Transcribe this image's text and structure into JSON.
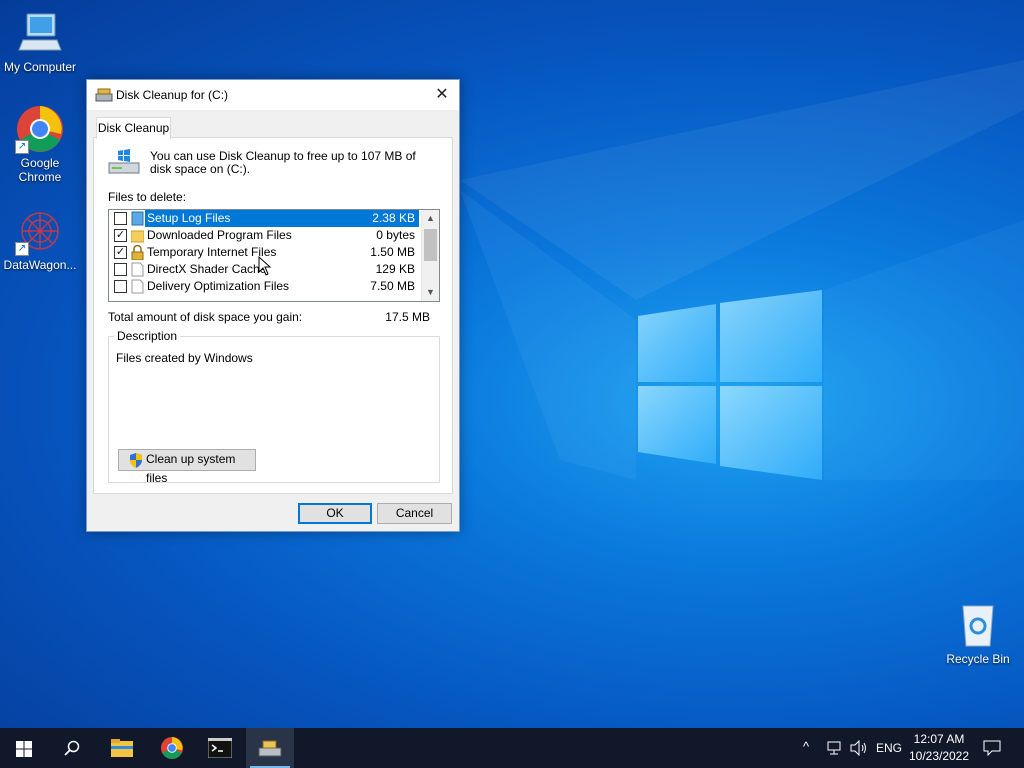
{
  "desktop": {
    "icons": [
      {
        "label": "My Computer"
      },
      {
        "label": "Google Chrome"
      },
      {
        "label": "DataWagon..."
      },
      {
        "label": "Recycle Bin"
      }
    ]
  },
  "dialog": {
    "title": "Disk Cleanup for  (C:)",
    "tab": "Disk Cleanup",
    "intro": "You can use Disk Cleanup to free up to 107 MB of disk space on  (C:).",
    "files_label": "Files to delete:",
    "files": [
      {
        "name": "Setup Log Files",
        "size": "2.38 KB",
        "checked": false,
        "selected": true,
        "icon": "log-file-icon"
      },
      {
        "name": "Downloaded Program Files",
        "size": "0 bytes",
        "checked": true,
        "selected": false,
        "icon": "folder-icon"
      },
      {
        "name": "Temporary Internet Files",
        "size": "1.50 MB",
        "checked": true,
        "selected": false,
        "icon": "lock-icon"
      },
      {
        "name": "DirectX Shader Cache",
        "size": "129 KB",
        "checked": false,
        "selected": false,
        "icon": "file-icon"
      },
      {
        "name": "Delivery Optimization Files",
        "size": "7.50 MB",
        "checked": false,
        "selected": false,
        "icon": "file-icon"
      }
    ],
    "total_label": "Total amount of disk space you gain:",
    "total_value": "17.5 MB",
    "description_label": "Description",
    "description_text": "Files created by Windows",
    "cleanup_button": "Clean up system files",
    "ok_button": "OK",
    "cancel_button": "Cancel"
  },
  "taskbar": {
    "language": "ENG",
    "time": "12:07 AM",
    "date": "10/23/2022",
    "check_mark": "✓",
    "icons": [
      "start-icon",
      "search-icon",
      "file-explorer-icon",
      "chrome-icon",
      "command-prompt-icon",
      "disk-cleanup-icon"
    ]
  }
}
